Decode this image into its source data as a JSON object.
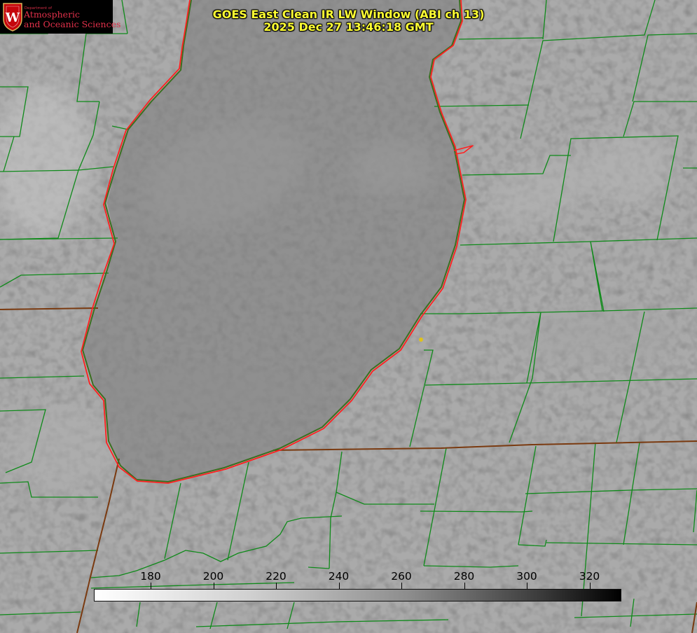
{
  "title": {
    "line1": "GOES East Clean IR LW Window (ABI ch 13)",
    "line2": "2025 Dec 27 13:46:18 GMT"
  },
  "logo": {
    "department_line": "Department of",
    "line1": "Atmospheric",
    "line2": "and Oceanic Sciences",
    "crest_letter": "W"
  },
  "colorbar": {
    "ticks": [
      "180",
      "200",
      "220",
      "240",
      "260",
      "280",
      "300",
      "320"
    ]
  },
  "colors": {
    "state_borders": "#7a3a10",
    "county_lines": "#0f8a1a",
    "lakeshore": "#ff2020",
    "title_text": "#ffff33",
    "logo_text": "#e0304a"
  },
  "icons": {
    "logo": "uw-crest-icon",
    "marker": "location-dot-icon"
  }
}
